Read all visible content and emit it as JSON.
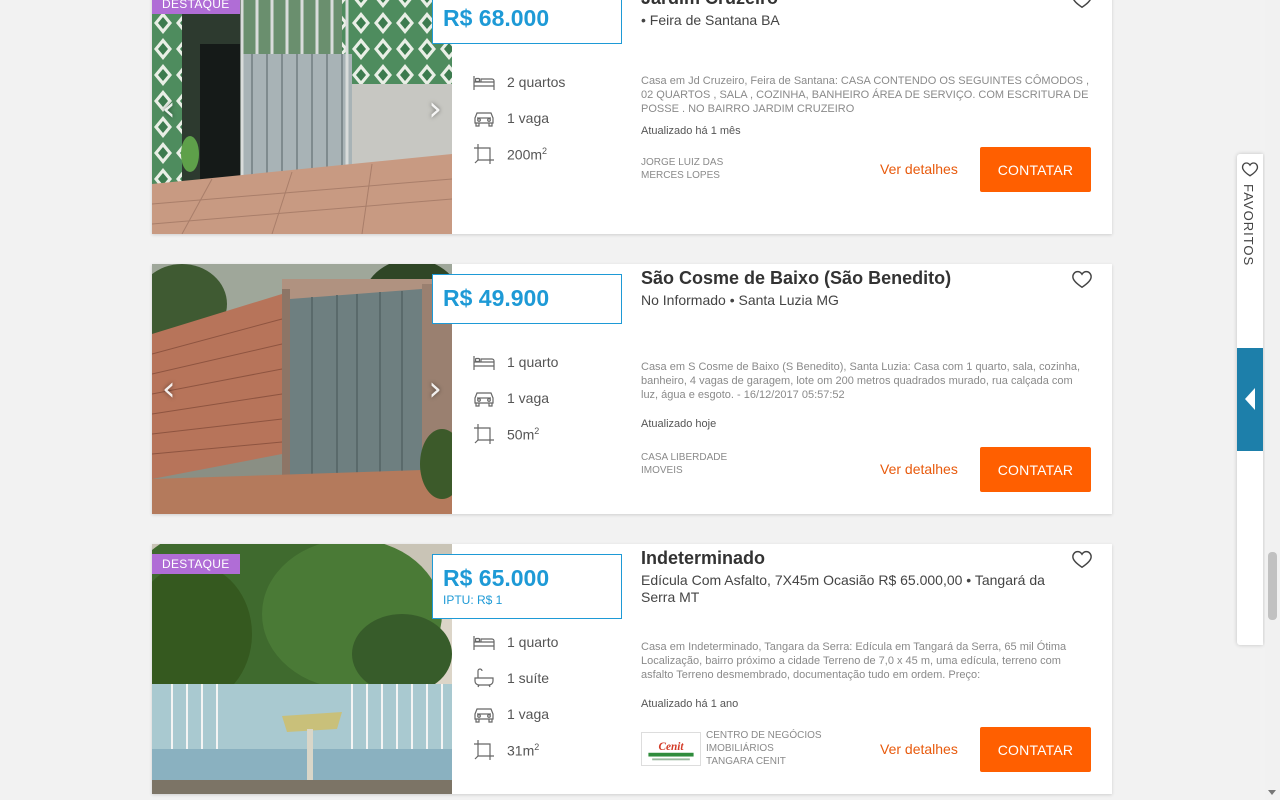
{
  "listings": [
    {
      "badge": "DESTAQUE",
      "price": "R$ 68.000",
      "iptu": "",
      "title": "Jardim Cruzeiro",
      "subtitle": "• Feira de Santana BA",
      "features": [
        {
          "icon": "bed-icon",
          "label": "2 quartos"
        },
        {
          "icon": "car-icon",
          "label": "1 vaga"
        },
        {
          "icon": "area-icon",
          "label": "200m",
          "sup": "2"
        }
      ],
      "description": "Casa em Jd Cruzeiro, Feira de Santana: CASA CONTENDO OS SEGUINTES CÔMODOS , 02 QUARTOS , SALA , COZINHA, BANHEIRO ÁREA DE SERVIÇO. COM ESCRITURA DE POSSE . NO BAIRRO JARDIM CRUZEIRO",
      "updated": "Atualizado há 1 mês",
      "agent": [
        "JORGE LUIZ DAS",
        "MERCES LOPES"
      ],
      "details": "Ver detalhes",
      "contact": "CONTATAR"
    },
    {
      "badge": "",
      "price": "R$ 49.900",
      "iptu": "",
      "title": "São Cosme de Baixo (São Benedito)",
      "subtitle": "No Informado • Santa Luzia MG",
      "features": [
        {
          "icon": "bed-icon",
          "label": "1 quarto"
        },
        {
          "icon": "car-icon",
          "label": "1 vaga"
        },
        {
          "icon": "area-icon",
          "label": "50m",
          "sup": "2"
        }
      ],
      "description": "Casa em S Cosme de Baixo (S Benedito), Santa Luzia: Casa com 1 quarto, sala, cozinha, banheiro, 4 vagas de garagem, lote om 200 metros quadrados murado, rua calçada com luz, água e esgoto. - 16/12/2017 05:57:52",
      "updated": "Atualizado hoje",
      "agent": [
        "CASA LIBERDADE",
        "IMOVEIS"
      ],
      "details": "Ver detalhes",
      "contact": "CONTATAR"
    },
    {
      "badge": "DESTAQUE",
      "price": "R$ 65.000",
      "iptu": "IPTU: R$ 1",
      "title": "Indeterminado",
      "subtitle": "Edícula Com Asfalto, 7X45m Ocasião R$ 65.000,00 • Tangará da Serra MT",
      "features": [
        {
          "icon": "bed-icon",
          "label": "1 quarto"
        },
        {
          "icon": "bathtub-icon",
          "label": "1 suíte"
        },
        {
          "icon": "car-icon",
          "label": "1 vaga"
        },
        {
          "icon": "area-icon",
          "label": "31m",
          "sup": "2"
        }
      ],
      "description": "Casa em Indeterminado, Tangara da Serra: Edícula em Tangará da Serra, 65 mil Ótima Localização, bairro próximo a cidade Terreno de 7,0 x 45 m, uma edícula, terreno com asfalto Terreno desmembrado, documentação tudo em ordem. Preço:",
      "updated": "Atualizado há 1 ano",
      "agent": [
        "CENTRO DE NEGÓCIOS",
        "IMOBILIÁRIOS",
        "TANGARA CENIT"
      ],
      "agent_logo_text": "Cenit",
      "details": "Ver detalhes",
      "contact": "CONTATAR"
    }
  ],
  "favorites_tab": {
    "label": "FAVORITOS"
  },
  "colors": {
    "accent_blue": "#1e9ad6",
    "orange": "#ff5f00",
    "badge_purple": "#b06dd6",
    "toggle_blue": "#1d7faa"
  },
  "nav": {
    "prev": "‹",
    "next": "›"
  }
}
